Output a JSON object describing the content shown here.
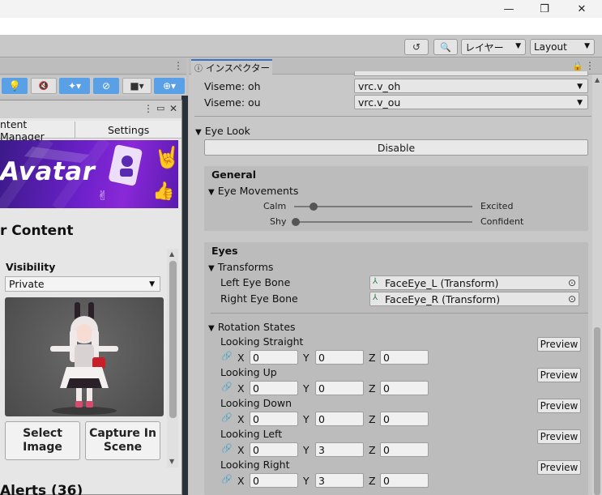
{
  "window": {
    "minimize_glyph": "—",
    "maximize_glyph": "❐",
    "close_glyph": "✕"
  },
  "toolbar": {
    "history_icon": "↺",
    "search_icon": "🔍",
    "layers_label": "レイヤー",
    "layout_label": "Layout"
  },
  "vcc": {
    "tabs": [
      "ntent Manager",
      "Settings"
    ],
    "banner_title": "Avatar",
    "content_title": "r Content",
    "visibility_label": "Visibility",
    "visibility_value": "Private",
    "select_image_label": "Select Image",
    "capture_label": "Capture In Scene",
    "alerts_label": "Alerts (36)"
  },
  "inspector": {
    "tab_label": "インスペクター",
    "viseme_oh_label": "Viseme: oh",
    "viseme_oh_value": "vrc.v_oh",
    "viseme_ou_label": "Viseme: ou",
    "viseme_ou_value": "vrc.v_ou",
    "eye_look_label": "Eye Look",
    "disable_label": "Disable",
    "general_title": "General",
    "eye_movements_label": "Eye Movements",
    "slider_calm": "Calm",
    "slider_excited": "Excited",
    "slider_shy": "Shy",
    "slider_confident": "Confident",
    "calm_excited_value": 0.1,
    "shy_confident_value": 0.0,
    "eyes_title": "Eyes",
    "transforms_label": "Transforms",
    "left_eye_label": "Left Eye Bone",
    "left_eye_value": "FaceEye_L (Transform)",
    "right_eye_label": "Right Eye Bone",
    "right_eye_value": "FaceEye_R (Transform)",
    "rotation_states_label": "Rotation States",
    "preview_label": "Preview",
    "states": [
      {
        "name": "Looking Straight",
        "x": "0",
        "y": "0",
        "z": "0"
      },
      {
        "name": "Looking Up",
        "x": "0",
        "y": "0",
        "z": "0"
      },
      {
        "name": "Looking Down",
        "x": "0",
        "y": "0",
        "z": "0"
      },
      {
        "name": "Looking Left",
        "x": "0",
        "y": "3",
        "z": "0"
      },
      {
        "name": "Looking Right",
        "x": "0",
        "y": "3",
        "z": "0"
      }
    ]
  }
}
